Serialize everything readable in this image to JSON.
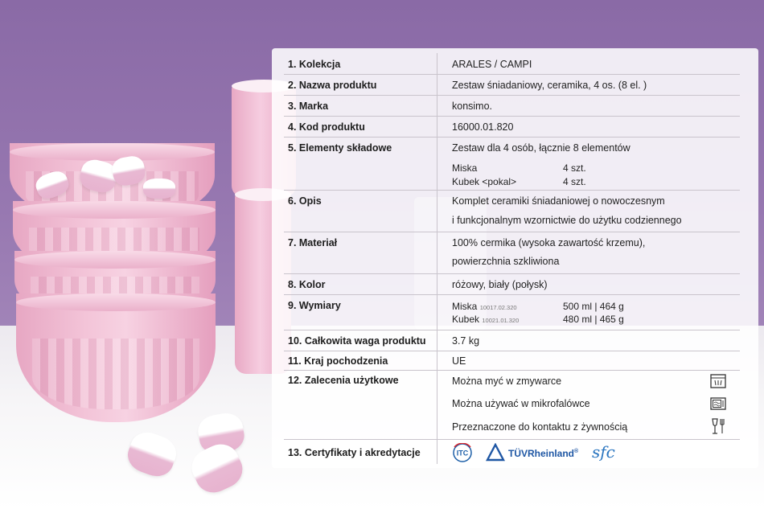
{
  "table": {
    "rows": [
      {
        "label": "1. Kolekcja",
        "value": "ARALES / CAMPI"
      },
      {
        "label": "2. Nazwa produktu",
        "value": "Zestaw śniadaniowy, ceramika, 4 os. (8 el. )"
      },
      {
        "label": "3. Marka",
        "value": "konsimo."
      },
      {
        "label": "4. Kod produktu",
        "value": "16000.01.820"
      },
      {
        "label": "5. Elementy składowe",
        "value": "Zestaw dla 4 osób, łącznie 8 elementów",
        "items": [
          {
            "name": "Miska",
            "qty": "4 szt."
          },
          {
            "name": "Kubek <pokal>",
            "qty": "4 szt."
          }
        ]
      },
      {
        "label": "6. Opis",
        "lines": [
          "Komplet ceramiki śniadaniowej o nowoczesnym",
          "i funkcjonalnym wzornictwie do użytku codziennego"
        ]
      },
      {
        "label": "7. Materiał",
        "lines": [
          "100% cermika (wysoka zawartość krzemu),",
          "powierzchnia szkliwiona"
        ]
      },
      {
        "label": "8. Kolor",
        "value": "różowy, biały (połysk)"
      },
      {
        "label": "9. Wymiary",
        "items": [
          {
            "name": "Miska",
            "code": "10017.02.320",
            "dims": "500 ml | 464 g"
          },
          {
            "name": "Kubek",
            "code": "10021.01.320",
            "dims": "480 ml | 465 g"
          }
        ]
      },
      {
        "label": "10. Całkowita waga produktu",
        "value": "3.7 kg"
      },
      {
        "label": "11. Kraj pochodzenia",
        "value": "UE"
      },
      {
        "label": "12. Zalecenia użytkowe",
        "items": [
          {
            "text": "Można myć w zmywarce",
            "icon": "dishwasher-icon"
          },
          {
            "text": "Można używać w mikrofalówce",
            "icon": "microwave-icon"
          },
          {
            "text": "Przeznaczone do kontaktu z żywnością",
            "icon": "food-safe-icon"
          }
        ]
      },
      {
        "label": "13. Certyfikaty i akredytacje",
        "certs": {
          "itc": "ITC",
          "tuv": "TÜVRheinland",
          "tuv_mark": "®",
          "sfc": "sfc"
        }
      }
    ]
  },
  "colors": {
    "wall": "#8a6aa6",
    "ceramic_pink": "#f3c4d8",
    "card_bg": "#ffffff",
    "itc_blue": "#1d5fa8",
    "itc_red": "#d8262d",
    "tuv_blue": "#1f57a4",
    "sfc_blue": "#2b76c0"
  }
}
